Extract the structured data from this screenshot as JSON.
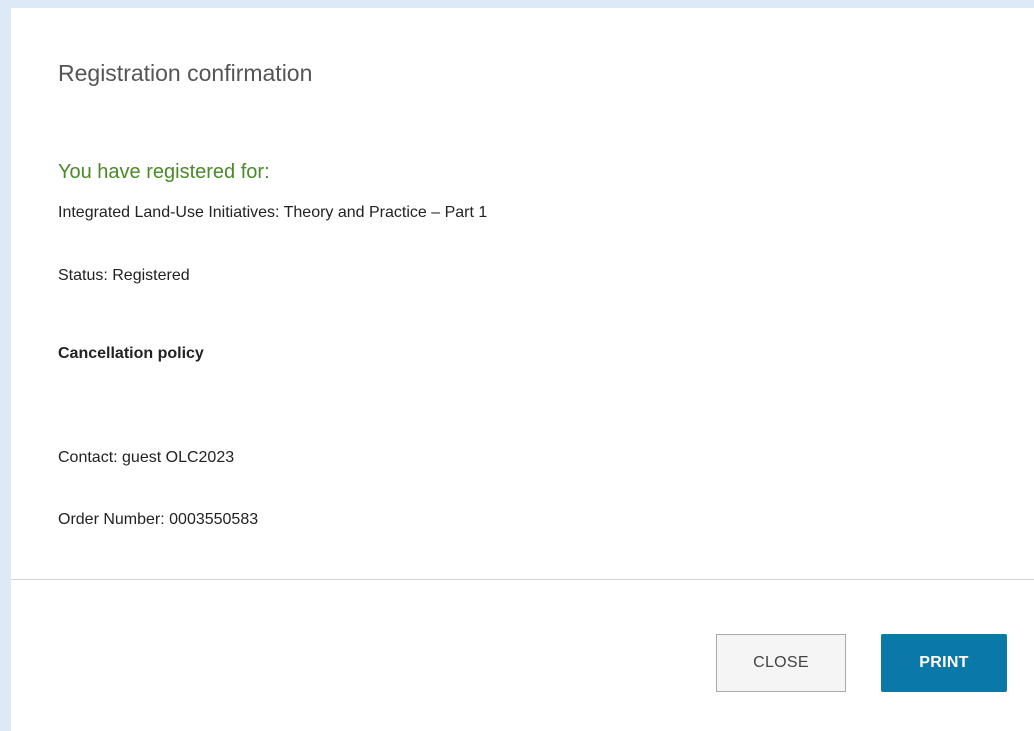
{
  "dialog": {
    "title": "Registration confirmation",
    "registered_heading": "You have registered for:",
    "course_title": "Integrated Land-Use Initiatives: Theory and Practice – Part 1",
    "status": "Status: Registered",
    "cancellation_policy_heading": "Cancellation policy",
    "contact": "Contact: guest OLC2023",
    "order_number": "Order Number: 0003550583"
  },
  "footer": {
    "close_label": "CLOSE",
    "print_label": "PRINT"
  },
  "colors": {
    "page_background": "#dde9f6",
    "heading_green": "#4a8a2a",
    "print_button": "#0a78a8"
  }
}
